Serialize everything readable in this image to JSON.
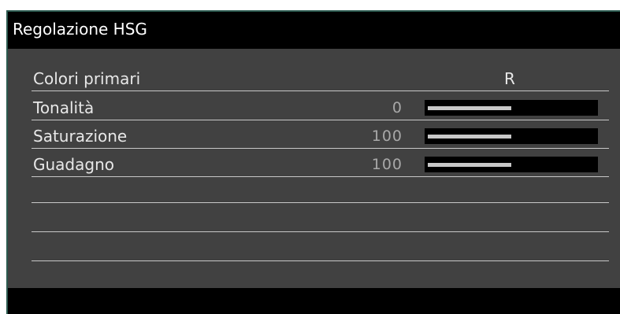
{
  "window": {
    "title": "Regolazione HSG"
  },
  "header_row": {
    "label": "Colori primari",
    "value": "R"
  },
  "settings": [
    {
      "label": "Tonalità",
      "value": "0",
      "level": 0.5
    },
    {
      "label": "Saturazione",
      "value": "100",
      "level": 0.5
    },
    {
      "label": "Guadagno",
      "value": "100",
      "level": 0.5
    }
  ],
  "empty_rows": 3,
  "colors": {
    "panel_bg": "#414141",
    "bar_bg": "#000000",
    "text": "#e8e8e8",
    "value_text": "#a8a8a8",
    "slider_fill": "#c8c8c8"
  }
}
